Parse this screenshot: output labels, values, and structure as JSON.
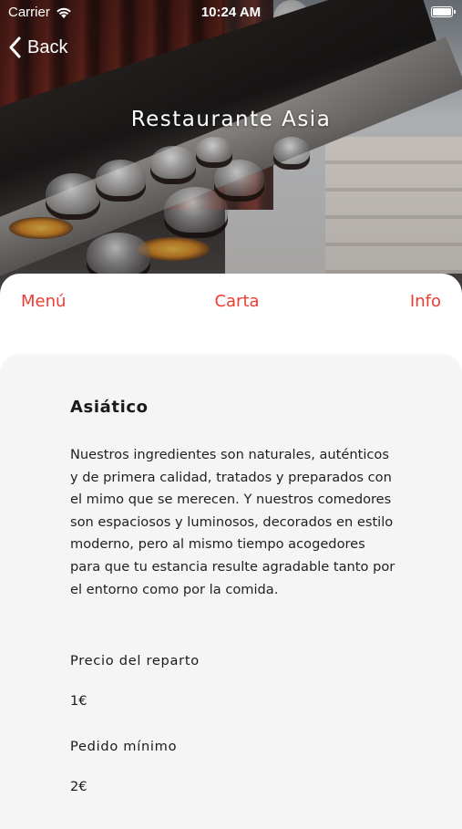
{
  "status_bar": {
    "carrier": "Carrier",
    "time": "10:24 AM",
    "wifi_icon": "wifi-icon",
    "battery_icon": "battery-icon"
  },
  "nav": {
    "back_label": "Back",
    "back_icon": "chevron-left-icon",
    "title": "Restaurante Asia"
  },
  "tabs": [
    {
      "label": "Menú"
    },
    {
      "label": "Carta"
    },
    {
      "label": "Info"
    }
  ],
  "info": {
    "heading": "Asiático",
    "description": "Nuestros ingredientes son naturales, auténticos y de primera calidad, tratados y preparados con el mimo que se merecen. Y nuestros comedores son espaciosos y luminosos, decorados en estilo moderno, pero al mismo tiempo acogedores para que tu estancia resulte agradable tanto por el entorno como por la comida.",
    "delivery_label": "Precio del reparto",
    "delivery_value": "1€",
    "min_order_label": "Pedido mínimo",
    "min_order_value": "2€"
  },
  "colors": {
    "accent": "#ef3b32",
    "background": "#f5f5f5",
    "sheet": "#ffffff",
    "text": "#1a1a1a"
  }
}
